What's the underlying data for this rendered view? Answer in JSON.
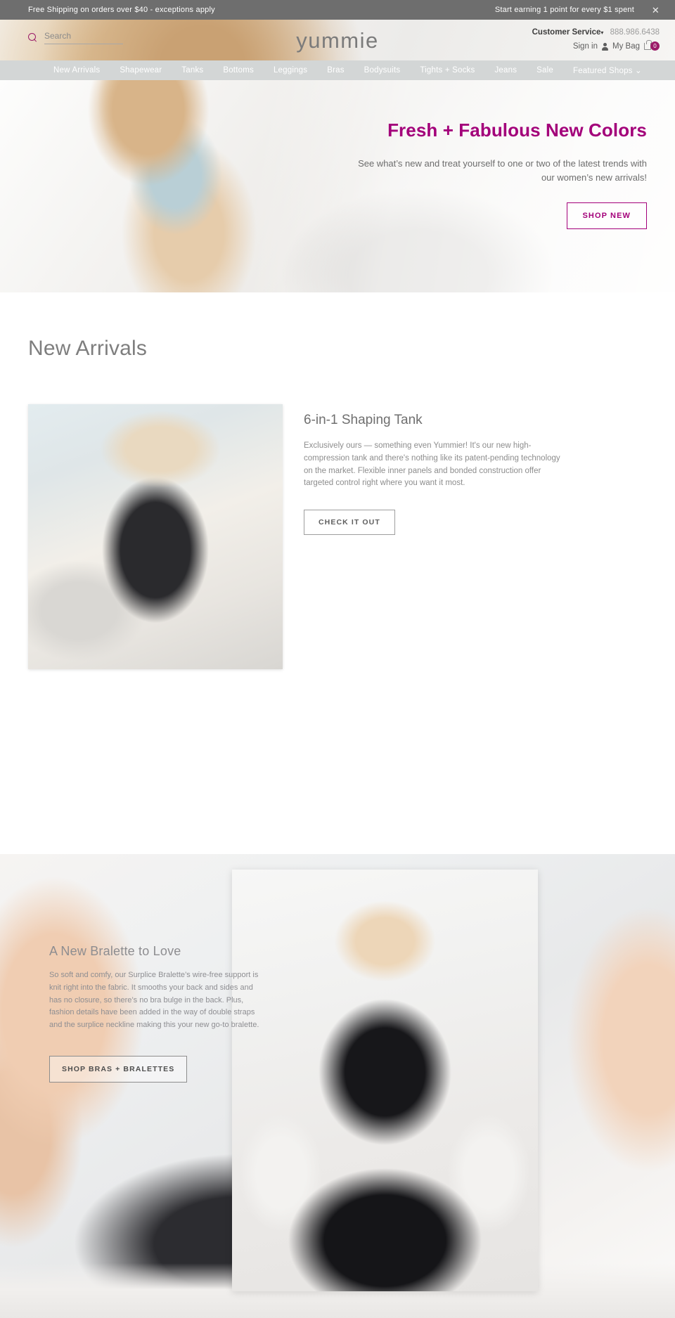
{
  "promo": {
    "left_text": "Free Shipping on orders over $40 - exceptions apply",
    "right_text": "Start earning 1 point for every $1 spent",
    "close_label": "✕"
  },
  "header": {
    "brand": "yummie",
    "search_placeholder": "Search",
    "search_value": "",
    "customer_service_label": "Customer Service",
    "customer_service_caret": "▾",
    "phone": "888.986.6438",
    "sign_in_label": "Sign in",
    "my_bag_label": "My Bag",
    "bag_count": "0"
  },
  "nav": {
    "items": [
      {
        "label": "New Arrivals"
      },
      {
        "label": "Shapewear"
      },
      {
        "label": "Tanks"
      },
      {
        "label": "Bottoms"
      },
      {
        "label": "Leggings"
      },
      {
        "label": "Bras"
      },
      {
        "label": "Bodysuits"
      },
      {
        "label": "Tights + Socks"
      },
      {
        "label": "Jeans"
      },
      {
        "label": "Sale"
      },
      {
        "label": "Featured Shops ⌄"
      }
    ]
  },
  "hero": {
    "title": "Fresh + Fabulous New Colors",
    "subtitle": "See what’s new and treat yourself to one or two of the latest trends with our women’s new arrivals!",
    "cta": "SHOP NEW",
    "accent_color": "#a3007a"
  },
  "new_arrivals": {
    "heading": "New Arrivals",
    "product": {
      "title": "6-in-1 Shaping Tank",
      "description": "Exclusively ours — something even Yummier! It's our new high-compression tank and there's nothing like its patent-pending technology on the market. Flexible inner panels and bonded construction offer targeted control right where you want it most.",
      "cta": "CHECK IT OUT"
    }
  },
  "bralette": {
    "title": "A New Bralette to Love",
    "description": "So soft and comfy, our Surplice Bralette’s wire-free support is knit right into the fabric. It smooths your back and sides and has no closure, so there’s no bra bulge in the back. Plus, fashion details have been added in the way of double straps and the surplice neckline making this your new go-to bralette.",
    "cta": "SHOP BRAS + BRALETTES"
  }
}
